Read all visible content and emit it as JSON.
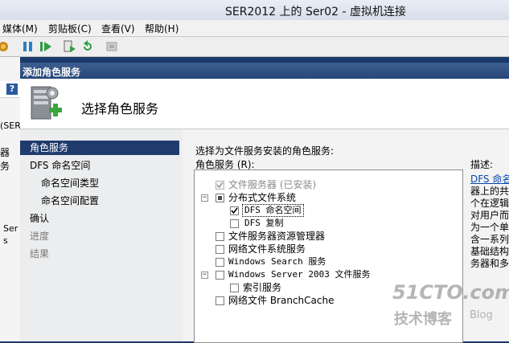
{
  "vm": {
    "title": "SER2012 上的 Ser02 - 虚拟机连接",
    "menu": [
      "媒体(M)",
      "剪贴板(C)",
      "查看(V)",
      "帮助(H)"
    ]
  },
  "guest_left": {
    "snippets": [
      "(SER",
      "器",
      "务",
      "Ser",
      "s"
    ]
  },
  "dialog": {
    "title": "添加角色服务",
    "header_title": "选择角色服务",
    "nav": [
      {
        "label": "角色服务",
        "selected": true,
        "muted": false
      },
      {
        "label": "DFS 命名空间",
        "selected": false,
        "muted": false
      },
      {
        "label": "命名空间类型",
        "selected": false,
        "muted": false
      },
      {
        "label": "命名空间配置",
        "selected": false,
        "muted": false
      },
      {
        "label": "确认",
        "selected": false,
        "muted": false
      },
      {
        "label": "进度",
        "selected": false,
        "muted": true
      },
      {
        "label": "结果",
        "selected": false,
        "muted": true
      }
    ],
    "instruction": "选择为文件服务安装的角色服务:",
    "list_label": "角色服务 (R):",
    "desc_label": "描述:",
    "tree": [
      {
        "label": "文件服务器   (已安装)",
        "state": "checked-disabled"
      },
      {
        "label": "分布式文件系统",
        "state": "indeterminate"
      },
      {
        "label": "DFS 命名空间",
        "state": "checked"
      },
      {
        "label": "DFS 复制",
        "state": "unchecked"
      },
      {
        "label": "文件服务器资源管理器",
        "state": "unchecked"
      },
      {
        "label": "网络文件系统服务",
        "state": "unchecked"
      },
      {
        "label": "Windows Search 服务",
        "state": "unchecked"
      },
      {
        "label": "Windows Server 2003 文件服务",
        "state": "unchecked"
      },
      {
        "label": "索引服务",
        "state": "unchecked"
      },
      {
        "label": "网络文件 BranchCache",
        "state": "unchecked"
      }
    ],
    "description_lines": [
      "DFS 命名",
      "器上的共",
      "个在逻辑",
      "对用户而",
      "为一个单",
      "含一系列",
      "基础结构",
      "务器和多"
    ]
  },
  "watermark": {
    "site": "51CTO.com",
    "sub": "技术博客",
    "blog": "Blog"
  },
  "colors": {
    "accent": "#27467a",
    "selection": "#1f3b6d",
    "link": "#0645ad"
  }
}
